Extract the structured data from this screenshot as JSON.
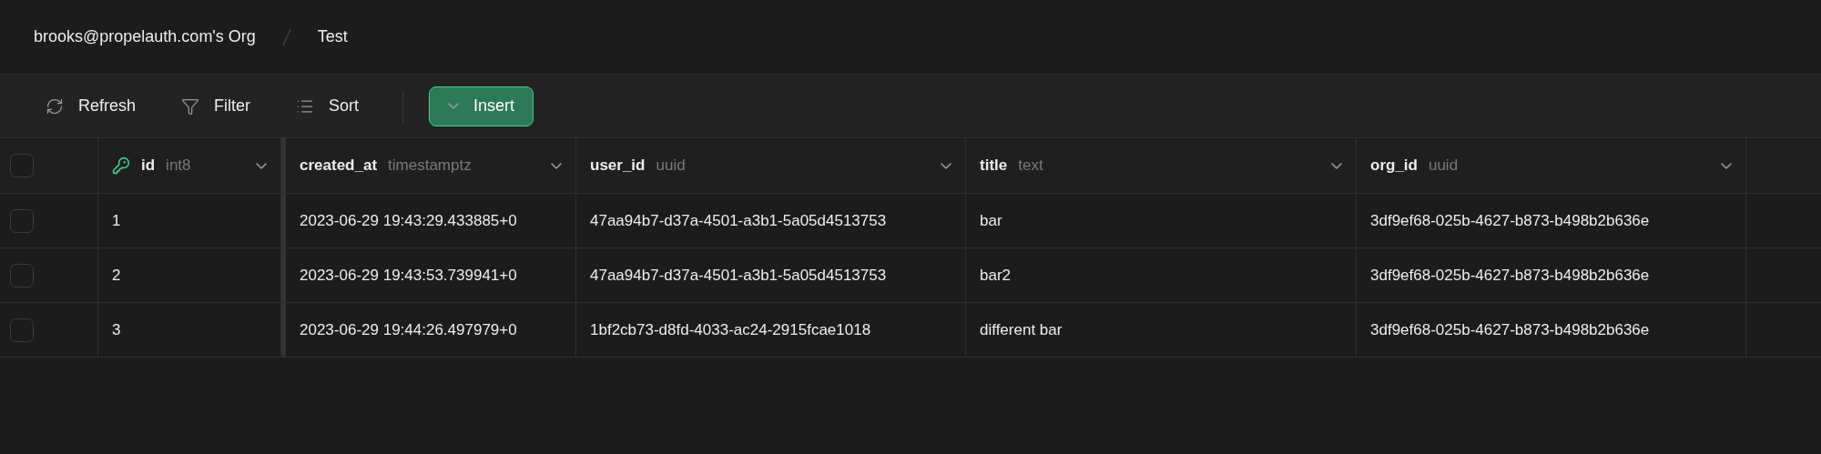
{
  "breadcrumb": [
    "brooks@propelauth.com's Org",
    "Test"
  ],
  "toolbar": [
    {
      "kind": "refresh",
      "label": "Refresh"
    },
    {
      "kind": "filter",
      "label": "Filter"
    },
    {
      "kind": "sort",
      "label": "Sort"
    },
    {
      "kind": "insert",
      "label": "Insert"
    }
  ],
  "table": {
    "all_checked": false,
    "columns": [
      {
        "name": "id",
        "type": "int8",
        "primary_key": true
      },
      {
        "name": "created_at",
        "type": "timestamptz",
        "primary_key": false
      },
      {
        "name": "user_id",
        "type": "uuid",
        "primary_key": false
      },
      {
        "name": "title",
        "type": "text",
        "primary_key": false
      },
      {
        "name": "org_id",
        "type": "uuid",
        "primary_key": false
      }
    ],
    "rows": [
      {
        "checked": false,
        "cells": [
          "1",
          "2023-06-29 19:43:29.433885+0",
          "47aa94b7-d37a-4501-a3b1-5a05d4513753",
          "bar",
          "3df9ef68-025b-4627-b873-b498b2b636e"
        ]
      },
      {
        "checked": false,
        "cells": [
          "2",
          "2023-06-29 19:43:53.739941+0",
          "47aa94b7-d37a-4501-a3b1-5a05d4513753",
          "bar2",
          "3df9ef68-025b-4627-b873-b498b2b636e"
        ]
      },
      {
        "checked": false,
        "cells": [
          "3",
          "2023-06-29 19:44:26.497979+0",
          "1bf2cb73-d8fd-4033-ac24-2915fcae1018",
          "different bar",
          "3df9ef68-025b-4627-b873-b498b2b636e"
        ]
      }
    ]
  }
}
